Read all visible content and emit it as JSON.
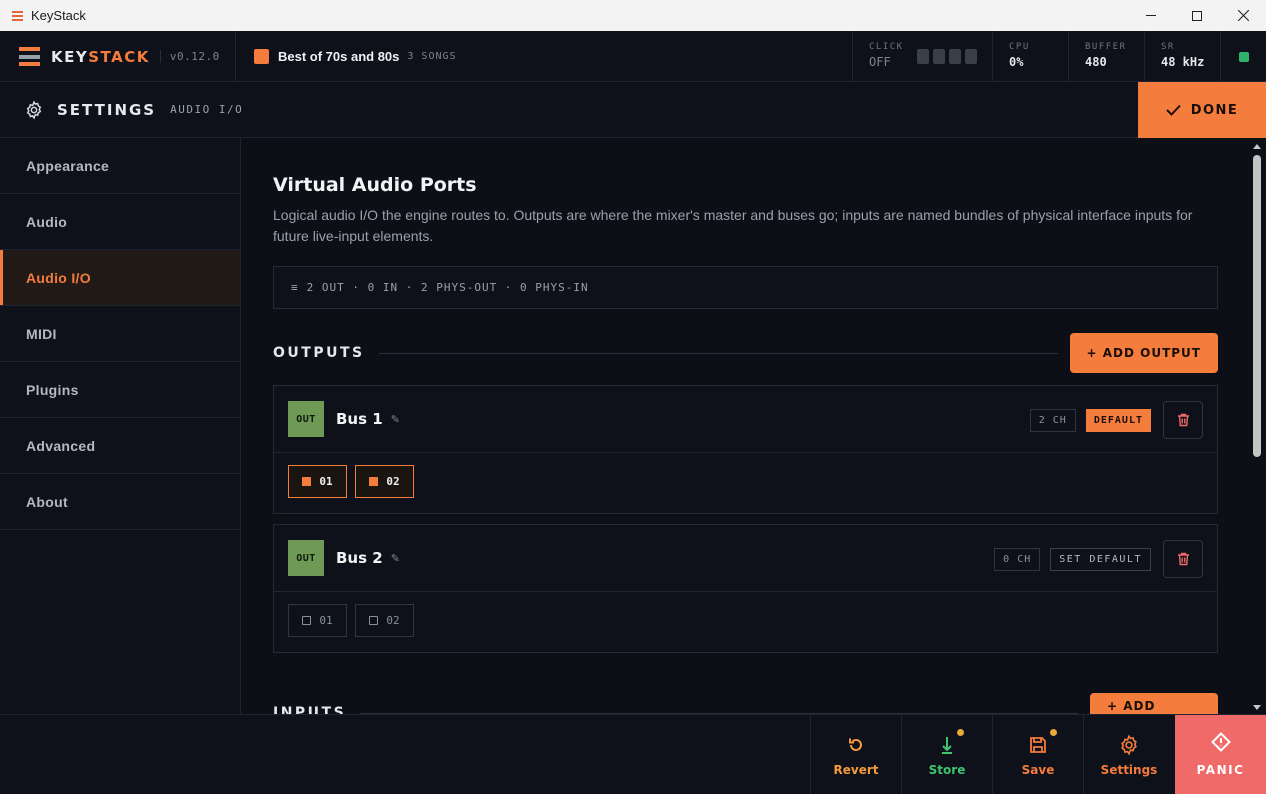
{
  "window": {
    "title": "KeyStack",
    "minimize": "—",
    "maximize": "☐",
    "close": "✕"
  },
  "brand": {
    "key": "KEY",
    "stack": "STACK",
    "version": "v0.12.0"
  },
  "setlist": {
    "name": "Best of 70s and 80s",
    "count": "3 SONGS"
  },
  "meters": {
    "click": {
      "label": "CLICK",
      "value": "OFF"
    },
    "cpu": {
      "label": "CPU",
      "value": "0%"
    },
    "buffer": {
      "label": "BUFFER",
      "value": "480"
    },
    "sr": {
      "label": "SR",
      "value": "48 kHz"
    }
  },
  "colors": {
    "accent": "#f47c3c",
    "status_ok": "#2fb36a",
    "out_badge": "#6e9a55",
    "panic": "#f06a6a",
    "store": "#3ec46d",
    "notify_dot": "#e8a93a"
  },
  "settings": {
    "heading": "SETTINGS",
    "subheading": "AUDIO I/O",
    "done_label": "DONE"
  },
  "sidebar": {
    "items": [
      {
        "label": "Appearance"
      },
      {
        "label": "Audio"
      },
      {
        "label": "Audio I/O"
      },
      {
        "label": "MIDI"
      },
      {
        "label": "Plugins"
      },
      {
        "label": "Advanced"
      },
      {
        "label": "About"
      }
    ],
    "active_index": 2
  },
  "main": {
    "title": "Virtual Audio Ports",
    "description": "Logical audio I/O the engine routes to. Outputs are where the mixer's master and buses go; inputs are named bundles of physical interface inputs for future live-input elements.",
    "summary": "2 OUT · 0 IN · 2 PHYS-OUT · 0 PHYS-IN",
    "outputs_label": "OUTPUTS",
    "add_output_label": "+ ADD OUTPUT",
    "inputs_label": "INPUTS",
    "add_input_label": "+ ADD INPUT",
    "buses": [
      {
        "badge": "OUT",
        "name": "Bus 1",
        "channels": "2 CH",
        "default_label": "DEFAULT",
        "is_default": true,
        "ports": [
          {
            "label": "01",
            "enabled": true
          },
          {
            "label": "02",
            "enabled": true
          }
        ]
      },
      {
        "badge": "OUT",
        "name": "Bus 2",
        "channels": "0 CH",
        "default_label": "SET DEFAULT",
        "is_default": false,
        "ports": [
          {
            "label": "01",
            "enabled": false
          },
          {
            "label": "02",
            "enabled": false
          }
        ]
      }
    ]
  },
  "bottombar": {
    "revert": "Revert",
    "store": "Store",
    "save": "Save",
    "settings": "Settings",
    "panic": "PANIC"
  }
}
